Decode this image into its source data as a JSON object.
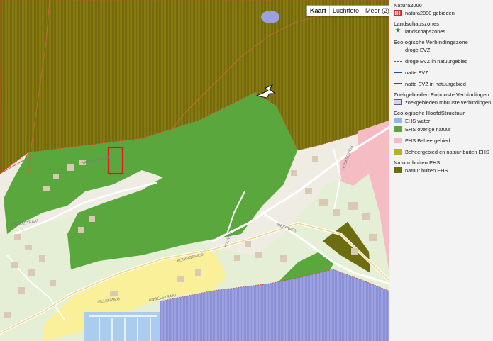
{
  "map_controls": {
    "buttons": [
      {
        "label": "Kaart",
        "active": true
      },
      {
        "label": "Luchtfoto",
        "active": false
      },
      {
        "label": "Meer (2)",
        "active": false
      }
    ]
  },
  "street_labels": {
    "s1": "BROEKSTRAAT",
    "s2": "KONINGSWEG",
    "s3": "MEERWEG",
    "s4": "DELLENWEG",
    "s5": "ANGELSTRAAT",
    "s6": "HOEKSEWEG",
    "s7": "OPERASTRAAT",
    "s8": "TOLWEG"
  },
  "colors": {
    "natuur_buiten_ehs": "#857a12",
    "ehs_overige_natuur": "#5aa83d",
    "ehs_beheergebied": "#f6bcc3",
    "ehs_water": "#9aa0e0",
    "natura2000_outline": "#e04040",
    "beheergebied_buiten": "#b3b327",
    "yellow_zone": "#faf09a",
    "water_blue": "#aaccee"
  },
  "legend": {
    "sections": [
      {
        "title": "Natura2000",
        "items": [
          {
            "label": "natura2000 gebieden",
            "swatch": "hatch-red",
            "icon": "hatched-swatch-icon"
          }
        ]
      },
      {
        "title": "Landschapszones",
        "items": [
          {
            "label": "landschapszones",
            "swatch": "star",
            "icon": "star-icon"
          }
        ]
      },
      {
        "title": "Ecologische Verbindingszone",
        "items": [
          {
            "label": "droge EVZ",
            "swatch": "line-brown",
            "icon": "line-icon"
          },
          {
            "label": "droge EVZ in natuurgebied",
            "swatch": "dash-gray",
            "icon": "dashed-line-icon"
          },
          {
            "label": "natte EVZ",
            "swatch": "line-blue",
            "icon": "line-icon"
          },
          {
            "label": "natte EVZ in natuurgebied",
            "swatch": "dash-blue",
            "icon": "dashed-line-icon"
          }
        ]
      },
      {
        "title": "Zoekgebieden Robuuste Verbindingen",
        "items": [
          {
            "label": "zoekgebieden robuuste verbindingen",
            "swatch": "box-lavender",
            "icon": "box-swatch-icon"
          }
        ]
      },
      {
        "title": "Ecologische HoofdStructuur",
        "items": [
          {
            "label": "EHS water",
            "swatch": "fill-water",
            "icon": "color-swatch-icon"
          },
          {
            "label": "EHS overige natuur",
            "swatch": "fill-green",
            "icon": "color-swatch-icon"
          },
          {
            "label": "EHS Beheergebied",
            "swatch": "fill-pink",
            "icon": "color-swatch-icon"
          },
          {
            "label": "Beheergebied en natuur buiten EHS",
            "swatch": "fill-olive",
            "icon": "color-swatch-icon"
          }
        ]
      },
      {
        "title": "Natuur buiten EHS",
        "items": [
          {
            "label": "natuur buiten EHS",
            "swatch": "fill-darkolive",
            "icon": "color-swatch-icon"
          }
        ]
      }
    ]
  }
}
